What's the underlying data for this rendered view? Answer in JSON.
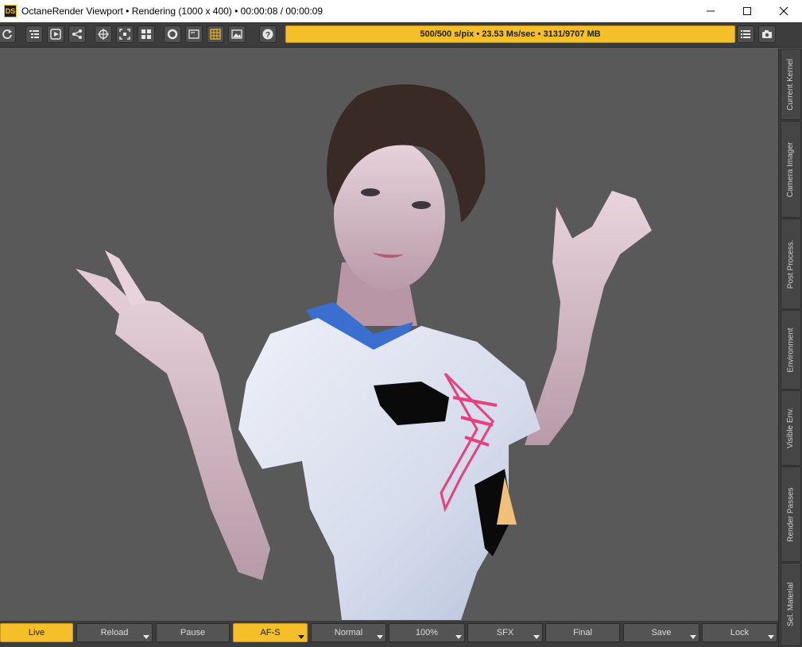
{
  "window": {
    "app_icon_text": "DS",
    "title": "OctaneRender Viewport • Rendering (1000 x 400) • 00:00:08 / 00:00:09",
    "controls": [
      "minimize",
      "maximize",
      "close"
    ]
  },
  "toolbar": {
    "buttons": [
      {
        "name": "refresh",
        "icon": "refresh-icon"
      },
      {
        "name": "scene-outliner",
        "icon": "outliner-icon"
      },
      {
        "name": "material-picker",
        "icon": "picker-icon"
      },
      {
        "name": "node-graph",
        "icon": "nodegraph-icon"
      },
      {
        "name": "focus-picker",
        "icon": "crosshair-icon"
      },
      {
        "name": "region-render",
        "icon": "region-icon"
      },
      {
        "name": "layout",
        "icon": "grid-icon"
      },
      {
        "name": "camera-view",
        "icon": "circle-icon"
      },
      {
        "name": "frame",
        "icon": "frame-icon"
      },
      {
        "name": "grid-overlay",
        "icon": "overlay-grid-icon"
      },
      {
        "name": "background-image",
        "icon": "image-icon"
      },
      {
        "name": "help",
        "icon": "help-icon"
      }
    ],
    "status": "500/500 s/pix • 23.53 Ms/sec • 3131/9707 MB",
    "right_buttons": [
      {
        "name": "menu",
        "icon": "list-icon"
      },
      {
        "name": "snapshot",
        "icon": "camera-icon"
      }
    ],
    "accent_color": "#f5bf2a"
  },
  "side_tabs": [
    "Current Kernel",
    "Camera Imager",
    "Post Process.",
    "Environment",
    "Visible Env.",
    "Render Passes",
    "Sel. Material"
  ],
  "bottom_buttons": [
    {
      "label": "Live",
      "active": true,
      "dropdown": false
    },
    {
      "label": "Reload",
      "active": false,
      "dropdown": true
    },
    {
      "label": "Pause",
      "active": false,
      "dropdown": false
    },
    {
      "label": "AF-S",
      "active": true,
      "dropdown": true
    },
    {
      "label": "Normal",
      "active": false,
      "dropdown": true
    },
    {
      "label": "100%",
      "active": false,
      "dropdown": true
    },
    {
      "label": "SFX",
      "active": false,
      "dropdown": true
    },
    {
      "label": "Final",
      "active": false,
      "dropdown": false
    },
    {
      "label": "Save",
      "active": false,
      "dropdown": true
    },
    {
      "label": "Lock",
      "active": false,
      "dropdown": true
    }
  ],
  "viewport": {
    "background_color": "#595959",
    "subject": "rendered-figure"
  }
}
